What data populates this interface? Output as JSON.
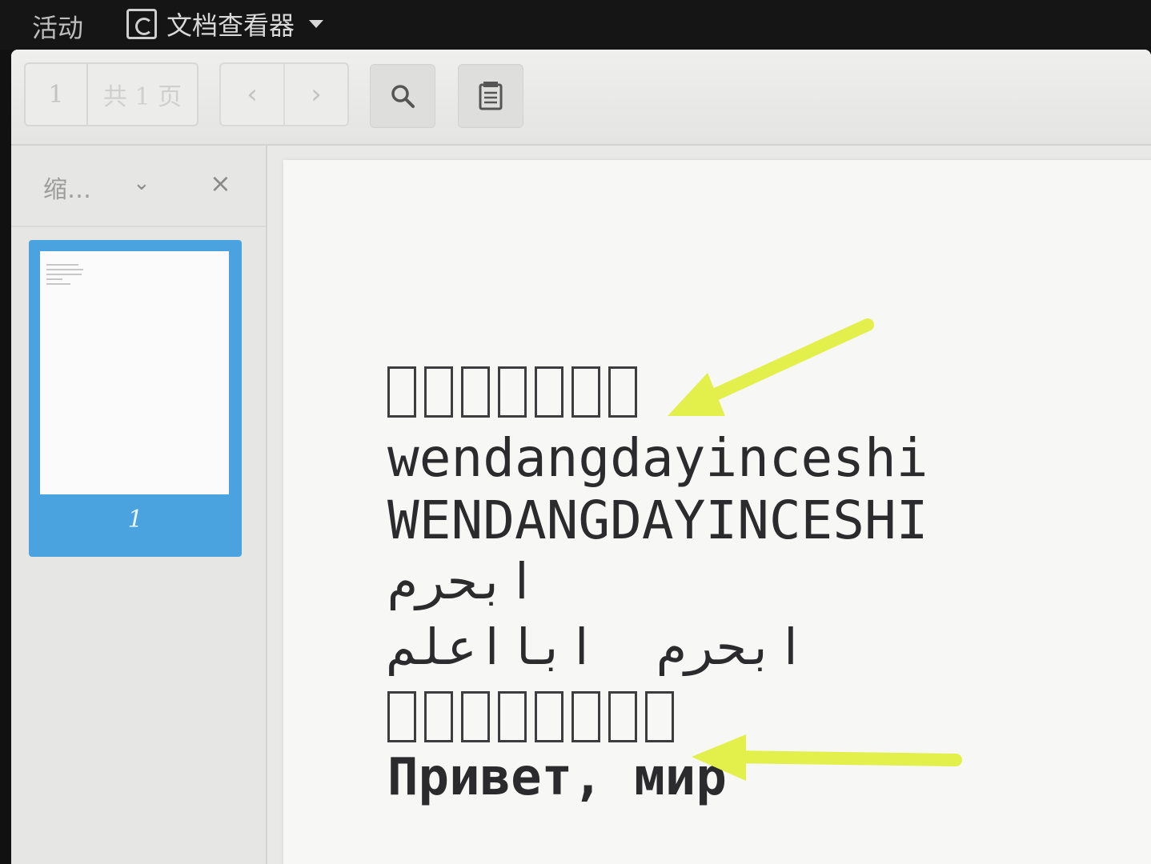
{
  "topbar": {
    "activities": "活动",
    "app_name": "文档查看器"
  },
  "toolbar": {
    "current_page": "1",
    "total_pages": "共 1 页",
    "prev_label": "‹",
    "next_label": "›"
  },
  "sidebar": {
    "title": "缩…",
    "thumbnails": [
      {
        "page_label": "1",
        "selected": true
      }
    ]
  },
  "document": {
    "lines": [
      {
        "text": "wendangdayinceshi"
      },
      {
        "text": "WENDANGDAYINCESHI"
      },
      {
        "text": "ابحرم"
      },
      {
        "text": "ابحرم  ابااعلم"
      },
      {
        "text": "Привет, мир"
      }
    ],
    "missing_glyph_rows": [
      {
        "count": 7
      },
      {
        "count": 8
      }
    ]
  },
  "colors": {
    "accent": "#4aa3df",
    "arrow": "#e3ef4a",
    "text": "#2b2b2d"
  }
}
